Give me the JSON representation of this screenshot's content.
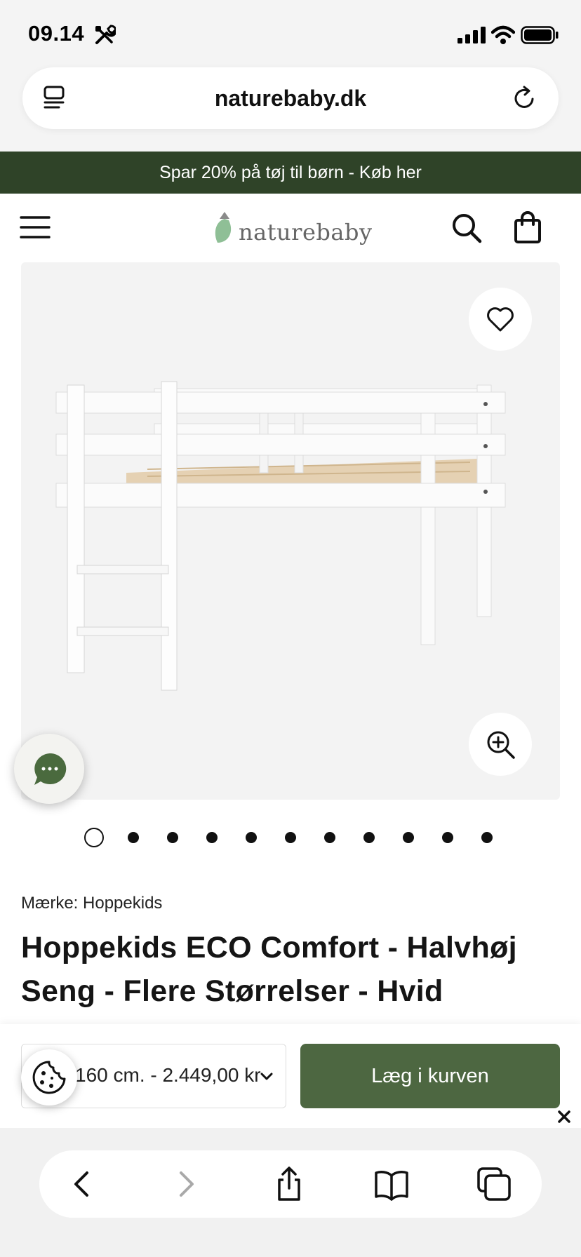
{
  "status_bar": {
    "time": "09.14"
  },
  "browser": {
    "domain": "naturebaby.dk"
  },
  "promo": {
    "text": "Spar 20% på tøj til børn - Køb her"
  },
  "header": {
    "logo_text": "naturebaby"
  },
  "gallery": {
    "total_images": 11,
    "active_index": 0
  },
  "product": {
    "brand": "Mærke: Hoppekids",
    "title": "Hoppekids ECO Comfort - Halvhøj Seng - Flere Størrelser - Hvid"
  },
  "purchase": {
    "variant_selected": "160 cm. - 2.449,00 kr",
    "add_to_cart": "Læg i kurven"
  },
  "colors": {
    "promo_bg": "#2f4328",
    "button_green": "#4d6741",
    "chat_green": "#4a6a3e"
  },
  "icons": [
    "tools-icon",
    "signal-icon",
    "wifi-icon",
    "battery-icon",
    "reader-icon",
    "reload-icon",
    "menu-icon",
    "search-icon",
    "bag-icon",
    "heart-icon",
    "zoom-in-icon",
    "chat-icon",
    "cookie-icon",
    "chevron-down-icon",
    "close-icon",
    "back-icon",
    "forward-icon",
    "share-icon",
    "bookmarks-icon",
    "tabs-icon"
  ]
}
